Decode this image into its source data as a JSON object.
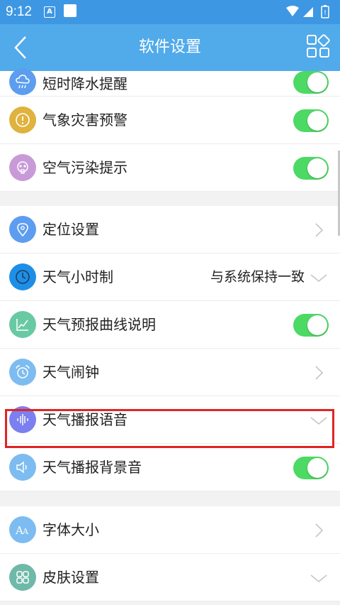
{
  "statusbar": {
    "time": "9:12",
    "notification_letter": "A"
  },
  "appbar": {
    "title": "软件设置"
  },
  "section1": [
    {
      "label": "短时降水提醒",
      "control": "toggle",
      "on": true,
      "icon": "rain-cloud-icon",
      "color": "#5d9df0"
    },
    {
      "label": "气象灾害预警",
      "control": "toggle",
      "on": true,
      "icon": "alert-icon",
      "color": "#e0b23e"
    },
    {
      "label": "空气污染提示",
      "control": "toggle",
      "on": true,
      "icon": "gas-mask-icon",
      "color": "#c99ad8"
    }
  ],
  "section2": [
    {
      "label": "定位设置",
      "control": "chevron-right",
      "icon": "location-pin-icon",
      "color": "#5d9df0"
    },
    {
      "label": "天气小时制",
      "control": "chevron-down",
      "value": "与系统保持一致",
      "icon": "clock-icon",
      "color": "#1e8fe6"
    },
    {
      "label": "天气预报曲线说明",
      "control": "toggle",
      "on": true,
      "icon": "chart-line-icon",
      "color": "#69c9a3"
    },
    {
      "label": "天气闹钟",
      "control": "chevron-right",
      "icon": "alarm-clock-icon",
      "color": "#7dbcf0"
    },
    {
      "label": "天气播报语音",
      "control": "chevron-down",
      "icon": "voice-wave-icon",
      "color": "#7b7ff0"
    },
    {
      "label": "天气播报背景音",
      "control": "toggle",
      "on": true,
      "icon": "speaker-icon",
      "color": "#7dbcf0"
    }
  ],
  "section3": [
    {
      "label": "字体大小",
      "control": "chevron-right",
      "icon": "font-size-icon",
      "color": "#7dbcf0"
    },
    {
      "label": "皮肤设置",
      "control": "chevron-down",
      "icon": "skin-grid-icon",
      "color": "#6fb9a8"
    }
  ],
  "colors": {
    "statusbar": "#3d97e3",
    "appbar": "#51aaea",
    "toggle_on": "#4cd964",
    "highlight": "#e02424"
  }
}
